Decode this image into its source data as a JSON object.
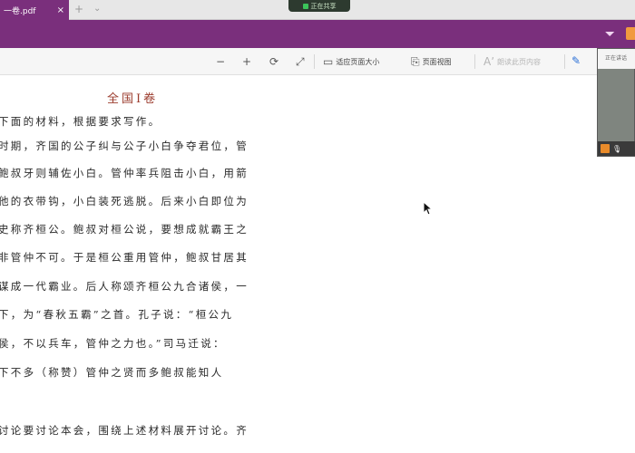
{
  "tabbar": {
    "active_tab": "一卷.pdf",
    "new_tab": "+",
    "tab_list": "⌄",
    "close": "×",
    "share_pill": "正在共享"
  },
  "toolbar": {
    "zoom_out": "−",
    "zoom_in": "+",
    "rotate": "⟳",
    "fit": "⤢",
    "actual_size": "适应页面大小",
    "single_page": "页面视图",
    "read_mode": "朗读此页内容",
    "annotate": "✎"
  },
  "video": {
    "top_label": "正在讲话"
  },
  "document": {
    "title": "全国Ⅰ卷",
    "lines": [
      "下面的材料，根据要求写作。",
      "时期，齐国的公子纠与公子小白争夺君位，管",
      "鲍叔牙则辅佐小白。管仲率兵阻击小白，用箭",
      "他的衣带钩，小白装死逃脱。后来小白即位为",
      "史称齐桓公。鲍叔对桓公说，要想成就霸王之",
      "非管仲不可。于是桓公重用管仲，鲍叔甘居其",
      "谋成一代霸业。后人称颂齐桓公九合诸侯，一",
      "下，为“春秋五霸”之首。孔子说：“桓公九",
      "侯，不以兵车，管仲之力也。”司马迁说：",
      "下不多（称赞）管仲之贤而多鲍叔能知人",
      "",
      "讨论要讨论本会，围绕上述材料展开讨论。齐"
    ]
  }
}
